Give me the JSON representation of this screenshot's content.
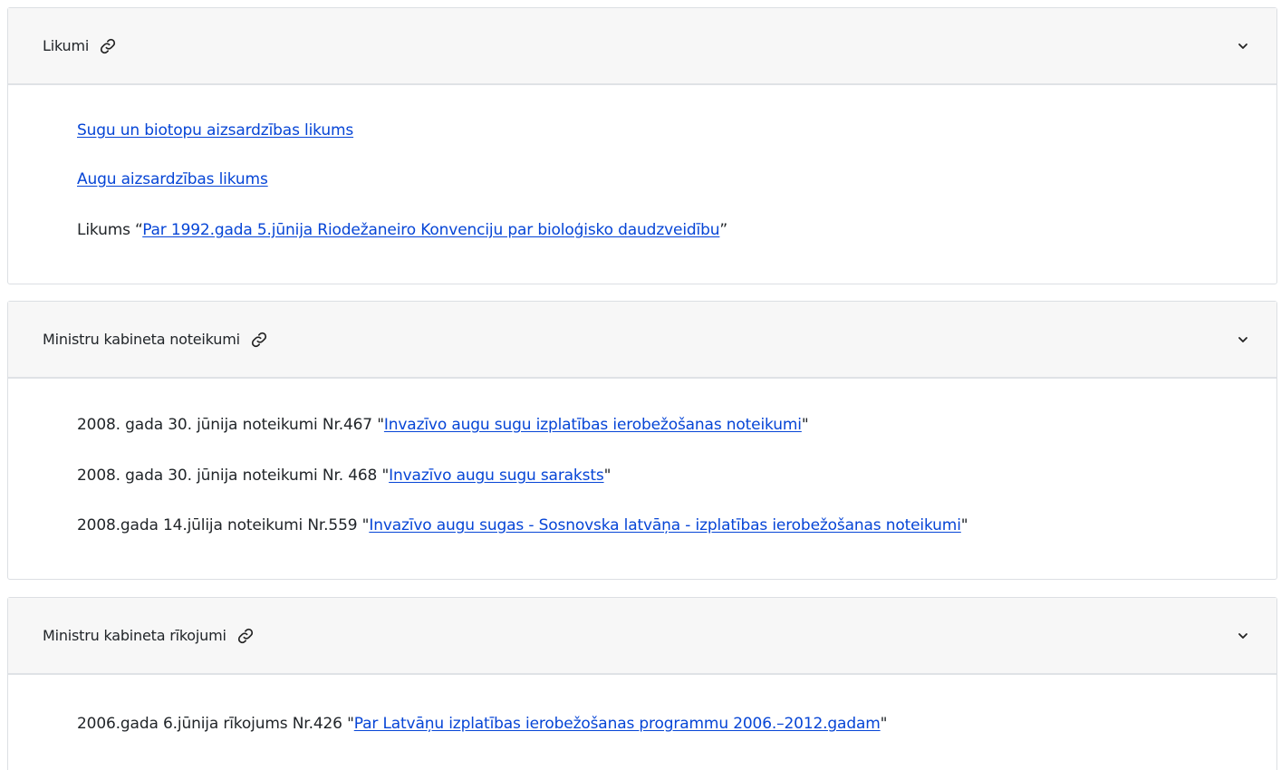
{
  "sections": [
    {
      "title": "Likumi",
      "items": [
        {
          "prefix": "",
          "link": "Sugu un biotopu aizsardzības likums",
          "suffix": ""
        },
        {
          "prefix": "",
          "link": "Augu aizsardzības likums",
          "suffix": ""
        },
        {
          "prefix": "Likums “",
          "link": "Par 1992.gada 5.jūnija Riodežaneiro Konvenciju par bioloģisko daudzveidību",
          "suffix": "”"
        }
      ]
    },
    {
      "title": "Ministru kabineta noteikumi",
      "items": [
        {
          "prefix": "2008. gada 30. jūnija noteikumi Nr.467 \"",
          "link": "Invazīvo augu sugu izplatības ierobežošanas noteikumi",
          "suffix": "\""
        },
        {
          "prefix": "2008. gada 30. jūnija noteikumi Nr. 468 \"",
          "link": "Invazīvo augu sugu saraksts",
          "suffix": "\""
        },
        {
          "prefix": "2008.gada 14.jūlija noteikumi Nr.559 \"",
          "link": "Invazīvo augu sugas - Sosnovska latvāņa - izplatības ierobežošanas noteikumi",
          "suffix": "\""
        }
      ]
    },
    {
      "title": "Ministru kabineta rīkojumi",
      "items": [
        {
          "prefix": "2006.gada 6.jūnija rīkojums Nr.426 \"",
          "link": "Par Latvāņu izplatības ierobežošanas programmu 2006.–2012.gadam",
          "suffix": "\""
        }
      ]
    }
  ],
  "icons": {
    "section_link": "link-icon",
    "section_toggle": "chevron-down-icon"
  },
  "colors": {
    "link": "#0645d6",
    "header_bg": "#f7f7f7",
    "text": "#212529"
  }
}
